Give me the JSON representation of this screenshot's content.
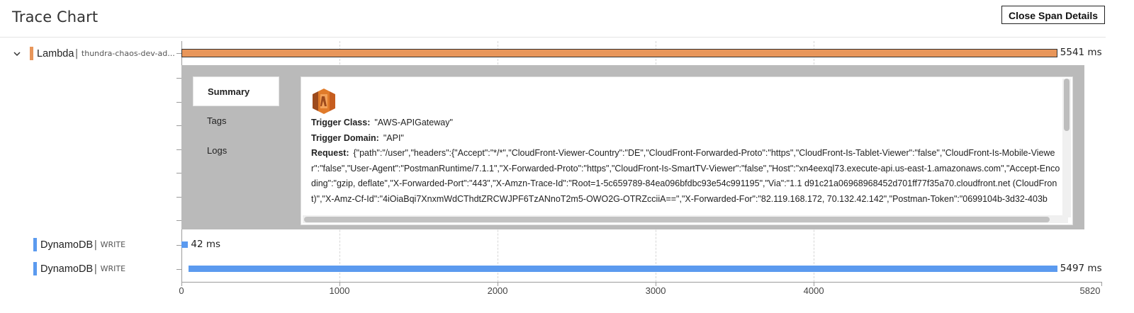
{
  "header": {
    "title": "Trace Chart",
    "close_label": "Close Span Details"
  },
  "colors": {
    "lambda": "#e8965a",
    "dynamodb": "#5b9aef",
    "panel_bg": "#bababa"
  },
  "rows": [
    {
      "service": "Lambda",
      "detail": "thundra-chaos-dev-ad...",
      "duration": "5541 ms",
      "start": 0,
      "end": 5541,
      "expanded": true,
      "icon": "chevron-down-icon"
    },
    {
      "service": "DynamoDB",
      "detail": "WRITE",
      "duration": "42 ms",
      "start": 0,
      "end": 42
    },
    {
      "service": "DynamoDB",
      "detail": "WRITE",
      "duration": "5497 ms",
      "start": 44,
      "end": 5541
    }
  ],
  "axis": {
    "min": 0,
    "max": 5820,
    "ticks": [
      "0",
      "1000",
      "2000",
      "3000",
      "4000",
      "5820"
    ]
  },
  "tabs": [
    {
      "label": "Summary",
      "active": true
    },
    {
      "label": "Tags",
      "active": false
    },
    {
      "label": "Logs",
      "active": false
    }
  ],
  "summary": {
    "icon": "aws-lambda-icon",
    "trigger_class_label": "Trigger Class:",
    "trigger_class_value": "\"AWS-APIGateway\"",
    "trigger_domain_label": "Trigger Domain:",
    "trigger_domain_value": "\"API\"",
    "request_label": "Request:",
    "request_value": "{\"path\":\"/user\",\"headers\":{\"Accept\":\"*/*\",\"CloudFront-Viewer-Country\":\"DE\",\"CloudFront-Forwarded-Proto\":\"https\",\"CloudFront-Is-Tablet-Viewer\":\"false\",\"CloudFront-Is-Mobile-Viewer\":\"false\",\"User-Agent\":\"PostmanRuntime/7.1.1\",\"X-Forwarded-Proto\":\"https\",\"CloudFront-Is-SmartTV-Viewer\":\"false\",\"Host\":\"xn4eexql73.execute-api.us-east-1.amazonaws.com\",\"Accept-Encoding\":\"gzip, deflate\",\"X-Forwarded-Port\":\"443\",\"X-Amzn-Trace-Id\":\"Root=1-5c659789-84ea096bfdbc93e54c991195\",\"Via\":\"1.1 d91c21a06968968452d701ff77f35a70.cloudfront.net (CloudFront)\",\"X-Amz-Cf-Id\":\"4iOiaBqi7XnxmWdCThdtZRCWJPF6TzANnoT2m5-OWO2G-OTRZcciiA==\",\"X-Forwarded-For\":\"82.119.168.172, 70.132.42.142\",\"Postman-Token\":\"0699104b-3d32-403b"
  }
}
